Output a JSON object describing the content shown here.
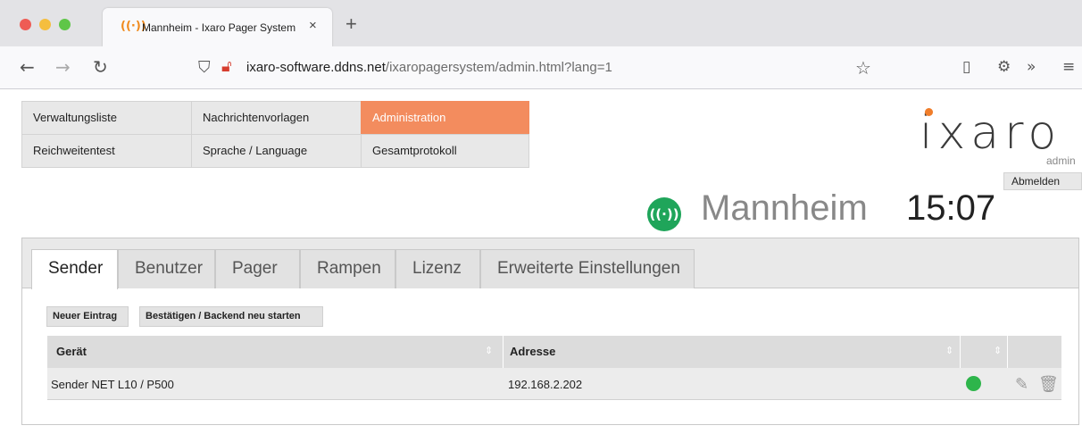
{
  "browser": {
    "tab_title": "Mannheim - Ixaro Pager System",
    "tab_icon": "radio-broadcast-icon",
    "close_glyph": "×",
    "new_tab_glyph": "+",
    "url_host": "ixaro-software.ddns.net",
    "url_path": "/ixaropagersystem/admin.html?lang=1"
  },
  "menu": {
    "row1": [
      "Verwaltungsliste",
      "Nachrichtenvorlagen",
      "Administration"
    ],
    "row2": [
      "Reichweitentest",
      "Sprache / Language",
      "Gesamtprotokoll"
    ],
    "active": "Administration",
    "active_color": "#f38c5e"
  },
  "header": {
    "logo_text": "ixaro",
    "user_role": "admin",
    "logout_label": "Abmelden",
    "station_name": "Mannheim",
    "time": "15:07",
    "status_color": "#1fa55a"
  },
  "tabs": [
    {
      "label": "Sender",
      "active": true
    },
    {
      "label": "Benutzer",
      "active": false
    },
    {
      "label": "Pager",
      "active": false
    },
    {
      "label": "Rampen",
      "active": false
    },
    {
      "label": "Lizenz",
      "active": false
    },
    {
      "label": "Erweiterte Einstellungen",
      "active": false
    }
  ],
  "actions": {
    "new_entry": "Neuer Eintrag",
    "confirm_restart": "Bestätigen / Backend neu starten"
  },
  "table": {
    "columns": [
      "Gerät",
      "Adresse"
    ],
    "rows": [
      {
        "device": "Sender NET L10 / P500",
        "address": "192.168.2.202",
        "status": "online",
        "status_color": "#2eb54b"
      }
    ]
  }
}
